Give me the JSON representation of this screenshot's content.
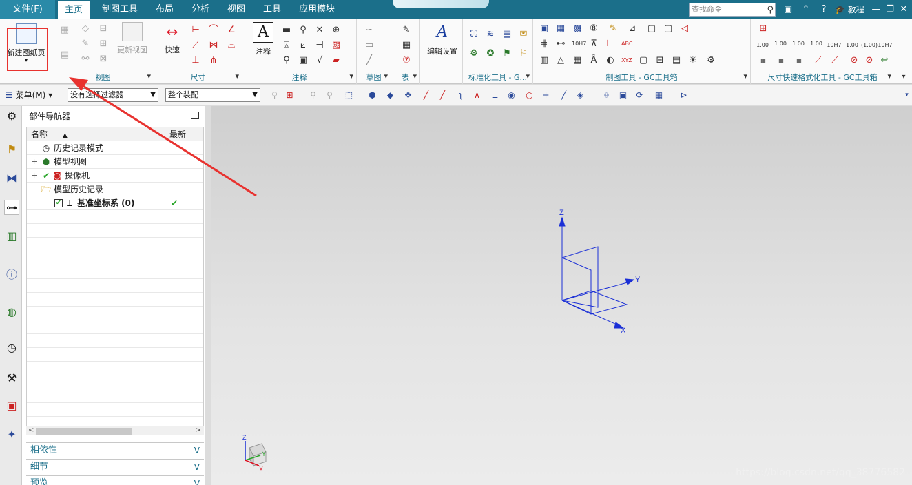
{
  "tabs": {
    "file": "文件(F)",
    "items": [
      "主页",
      "制图工具",
      "布局",
      "分析",
      "视图",
      "工具",
      "应用模块"
    ],
    "active_index": 0
  },
  "top_right": {
    "search_placeholder": "查找命令",
    "tutorial": "教程"
  },
  "ribbon": {
    "new_sheet": "新建图纸页",
    "update_view": "更新视图",
    "group_view": "视图",
    "quick": "快速",
    "group_dimension": "尺寸",
    "annotation": "注释",
    "group_annotation": "注释",
    "group_sketch": "草图",
    "group_table": "表",
    "edit_settings": "编辑设置",
    "group_standard": "标准化工具 - G...",
    "group_drafting_gc": "制图工具 - GC工具箱",
    "group_dim_format": "尺寸快速格式化工具 - GC工具箱",
    "tol_labels": [
      "1.00",
      "1.00",
      "1.00",
      "1.00",
      "10H7"
    ],
    "tol_labels2": [
      "1.00",
      "(1.00)",
      "10H7"
    ]
  },
  "toolbar2": {
    "menu": "菜单(M)",
    "filter": "没有选择过滤器",
    "scope": "整个装配"
  },
  "navigator": {
    "title": "部件导航器",
    "col_name": "名称",
    "col_latest": "最新",
    "rows": [
      {
        "label": "历史记录模式"
      },
      {
        "label": "模型视图"
      },
      {
        "label": "摄像机"
      },
      {
        "label": "模型历史记录"
      },
      {
        "label": "基准坐标系 (0)"
      }
    ],
    "sections": [
      "相依性",
      "细节",
      "预览"
    ]
  },
  "canvas": {
    "axis_x": "X",
    "axis_y": "Y",
    "axis_z": "Z",
    "watermark": "https://blog.csdn.net/qq_38776582"
  },
  "colors": {
    "title_bar": "#1b6f8a",
    "accent": "#1b6f8a",
    "highlight": "#e8322f",
    "axis": "#1a2fd6"
  }
}
